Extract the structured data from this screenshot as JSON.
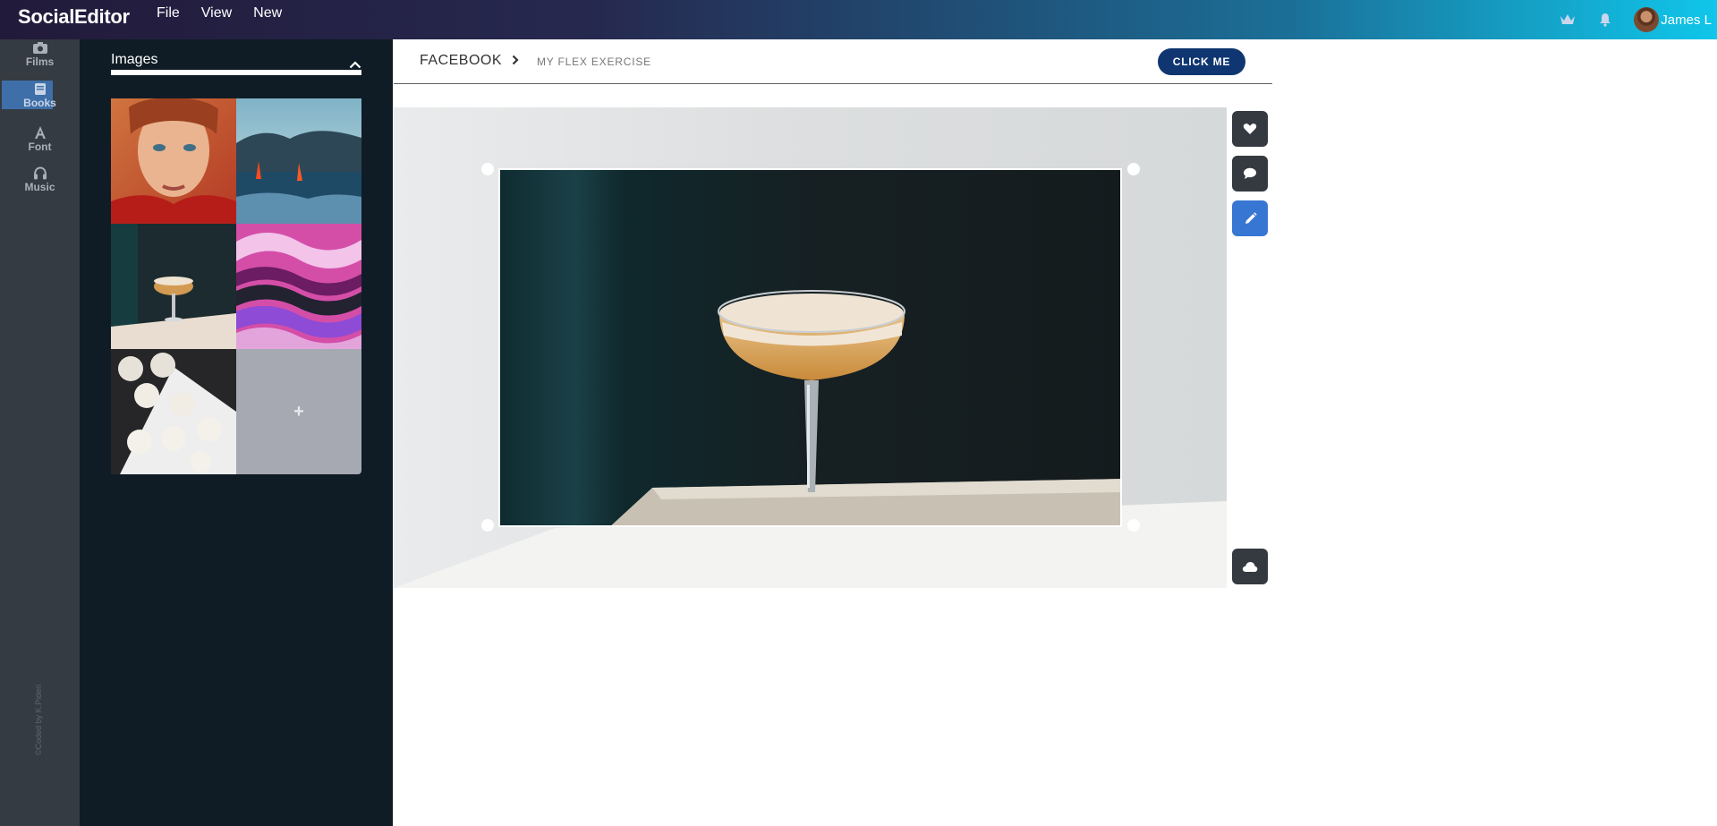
{
  "app": {
    "brand": "SocialEditor",
    "menu": [
      {
        "label": "File"
      },
      {
        "label": "View"
      },
      {
        "label": "New"
      }
    ],
    "user": {
      "name": "James L",
      "avatar_icon": "user-avatar"
    },
    "top_icons": [
      "crown-icon",
      "bell-icon"
    ]
  },
  "rail": {
    "items": [
      {
        "label": "Films",
        "icon": "camera-icon"
      },
      {
        "label": "Books",
        "icon": "book-icon",
        "active": true
      },
      {
        "label": "Font",
        "icon": "font-icon"
      },
      {
        "label": "Music",
        "icon": "headphones-icon"
      }
    ],
    "credit": "©Coded by K.Pideri"
  },
  "images_panel": {
    "title": "Images",
    "thumbnails": [
      {
        "name": "woman-portrait"
      },
      {
        "name": "lava-ocean"
      },
      {
        "name": "cocktail-glass"
      },
      {
        "name": "pink-waves"
      },
      {
        "name": "meringues"
      }
    ],
    "add_label": "+"
  },
  "breadcrumb": {
    "section": "FACEBOOK",
    "page": "MY FLEX EXERCISE"
  },
  "action_button": {
    "label": "CLICK ME"
  },
  "tools": [
    "heart-icon",
    "comment-icon",
    "pencil-icon",
    "cloud-icon"
  ],
  "colors": {
    "primary_button": "#0f3670",
    "active_tool": "#3777d3",
    "rail_active": "#3f6fa8"
  }
}
